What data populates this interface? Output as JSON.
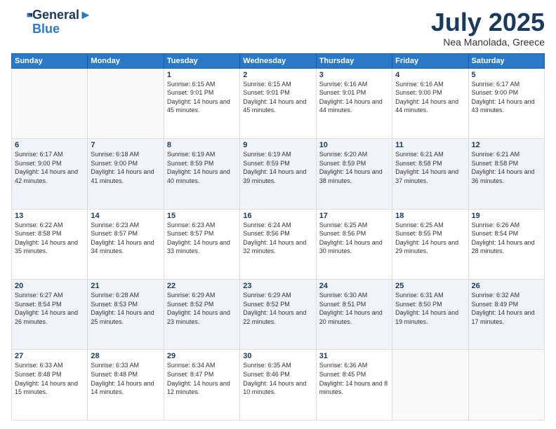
{
  "header": {
    "logo_line1": "General",
    "logo_line2": "Blue",
    "month": "July 2025",
    "location": "Nea Manolada, Greece"
  },
  "weekdays": [
    "Sunday",
    "Monday",
    "Tuesday",
    "Wednesday",
    "Thursday",
    "Friday",
    "Saturday"
  ],
  "weeks": [
    [
      {
        "day": "",
        "empty": true
      },
      {
        "day": "",
        "empty": true
      },
      {
        "day": "1",
        "sunrise": "Sunrise: 6:15 AM",
        "sunset": "Sunset: 9:01 PM",
        "daylight": "Daylight: 14 hours and 45 minutes."
      },
      {
        "day": "2",
        "sunrise": "Sunrise: 6:15 AM",
        "sunset": "Sunset: 9:01 PM",
        "daylight": "Daylight: 14 hours and 45 minutes."
      },
      {
        "day": "3",
        "sunrise": "Sunrise: 6:16 AM",
        "sunset": "Sunset: 9:01 PM",
        "daylight": "Daylight: 14 hours and 44 minutes."
      },
      {
        "day": "4",
        "sunrise": "Sunrise: 6:16 AM",
        "sunset": "Sunset: 9:00 PM",
        "daylight": "Daylight: 14 hours and 44 minutes."
      },
      {
        "day": "5",
        "sunrise": "Sunrise: 6:17 AM",
        "sunset": "Sunset: 9:00 PM",
        "daylight": "Daylight: 14 hours and 43 minutes."
      }
    ],
    [
      {
        "day": "6",
        "sunrise": "Sunrise: 6:17 AM",
        "sunset": "Sunset: 9:00 PM",
        "daylight": "Daylight: 14 hours and 42 minutes."
      },
      {
        "day": "7",
        "sunrise": "Sunrise: 6:18 AM",
        "sunset": "Sunset: 9:00 PM",
        "daylight": "Daylight: 14 hours and 41 minutes."
      },
      {
        "day": "8",
        "sunrise": "Sunrise: 6:19 AM",
        "sunset": "Sunset: 8:59 PM",
        "daylight": "Daylight: 14 hours and 40 minutes."
      },
      {
        "day": "9",
        "sunrise": "Sunrise: 6:19 AM",
        "sunset": "Sunset: 8:59 PM",
        "daylight": "Daylight: 14 hours and 39 minutes."
      },
      {
        "day": "10",
        "sunrise": "Sunrise: 6:20 AM",
        "sunset": "Sunset: 8:59 PM",
        "daylight": "Daylight: 14 hours and 38 minutes."
      },
      {
        "day": "11",
        "sunrise": "Sunrise: 6:21 AM",
        "sunset": "Sunset: 8:58 PM",
        "daylight": "Daylight: 14 hours and 37 minutes."
      },
      {
        "day": "12",
        "sunrise": "Sunrise: 6:21 AM",
        "sunset": "Sunset: 8:58 PM",
        "daylight": "Daylight: 14 hours and 36 minutes."
      }
    ],
    [
      {
        "day": "13",
        "sunrise": "Sunrise: 6:22 AM",
        "sunset": "Sunset: 8:58 PM",
        "daylight": "Daylight: 14 hours and 35 minutes."
      },
      {
        "day": "14",
        "sunrise": "Sunrise: 6:23 AM",
        "sunset": "Sunset: 8:57 PM",
        "daylight": "Daylight: 14 hours and 34 minutes."
      },
      {
        "day": "15",
        "sunrise": "Sunrise: 6:23 AM",
        "sunset": "Sunset: 8:57 PM",
        "daylight": "Daylight: 14 hours and 33 minutes."
      },
      {
        "day": "16",
        "sunrise": "Sunrise: 6:24 AM",
        "sunset": "Sunset: 8:56 PM",
        "daylight": "Daylight: 14 hours and 32 minutes."
      },
      {
        "day": "17",
        "sunrise": "Sunrise: 6:25 AM",
        "sunset": "Sunset: 8:56 PM",
        "daylight": "Daylight: 14 hours and 30 minutes."
      },
      {
        "day": "18",
        "sunrise": "Sunrise: 6:25 AM",
        "sunset": "Sunset: 8:55 PM",
        "daylight": "Daylight: 14 hours and 29 minutes."
      },
      {
        "day": "19",
        "sunrise": "Sunrise: 6:26 AM",
        "sunset": "Sunset: 8:54 PM",
        "daylight": "Daylight: 14 hours and 28 minutes."
      }
    ],
    [
      {
        "day": "20",
        "sunrise": "Sunrise: 6:27 AM",
        "sunset": "Sunset: 8:54 PM",
        "daylight": "Daylight: 14 hours and 26 minutes."
      },
      {
        "day": "21",
        "sunrise": "Sunrise: 6:28 AM",
        "sunset": "Sunset: 8:53 PM",
        "daylight": "Daylight: 14 hours and 25 minutes."
      },
      {
        "day": "22",
        "sunrise": "Sunrise: 6:29 AM",
        "sunset": "Sunset: 8:52 PM",
        "daylight": "Daylight: 14 hours and 23 minutes."
      },
      {
        "day": "23",
        "sunrise": "Sunrise: 6:29 AM",
        "sunset": "Sunset: 8:52 PM",
        "daylight": "Daylight: 14 hours and 22 minutes."
      },
      {
        "day": "24",
        "sunrise": "Sunrise: 6:30 AM",
        "sunset": "Sunset: 8:51 PM",
        "daylight": "Daylight: 14 hours and 20 minutes."
      },
      {
        "day": "25",
        "sunrise": "Sunrise: 6:31 AM",
        "sunset": "Sunset: 8:50 PM",
        "daylight": "Daylight: 14 hours and 19 minutes."
      },
      {
        "day": "26",
        "sunrise": "Sunrise: 6:32 AM",
        "sunset": "Sunset: 8:49 PM",
        "daylight": "Daylight: 14 hours and 17 minutes."
      }
    ],
    [
      {
        "day": "27",
        "sunrise": "Sunrise: 6:33 AM",
        "sunset": "Sunset: 8:48 PM",
        "daylight": "Daylight: 14 hours and 15 minutes."
      },
      {
        "day": "28",
        "sunrise": "Sunrise: 6:33 AM",
        "sunset": "Sunset: 8:48 PM",
        "daylight": "Daylight: 14 hours and 14 minutes."
      },
      {
        "day": "29",
        "sunrise": "Sunrise: 6:34 AM",
        "sunset": "Sunset: 8:47 PM",
        "daylight": "Daylight: 14 hours and 12 minutes."
      },
      {
        "day": "30",
        "sunrise": "Sunrise: 6:35 AM",
        "sunset": "Sunset: 8:46 PM",
        "daylight": "Daylight: 14 hours and 10 minutes."
      },
      {
        "day": "31",
        "sunrise": "Sunrise: 6:36 AM",
        "sunset": "Sunset: 8:45 PM",
        "daylight": "Daylight: 14 hours and 8 minutes."
      },
      {
        "day": "",
        "empty": true
      },
      {
        "day": "",
        "empty": true
      }
    ]
  ]
}
